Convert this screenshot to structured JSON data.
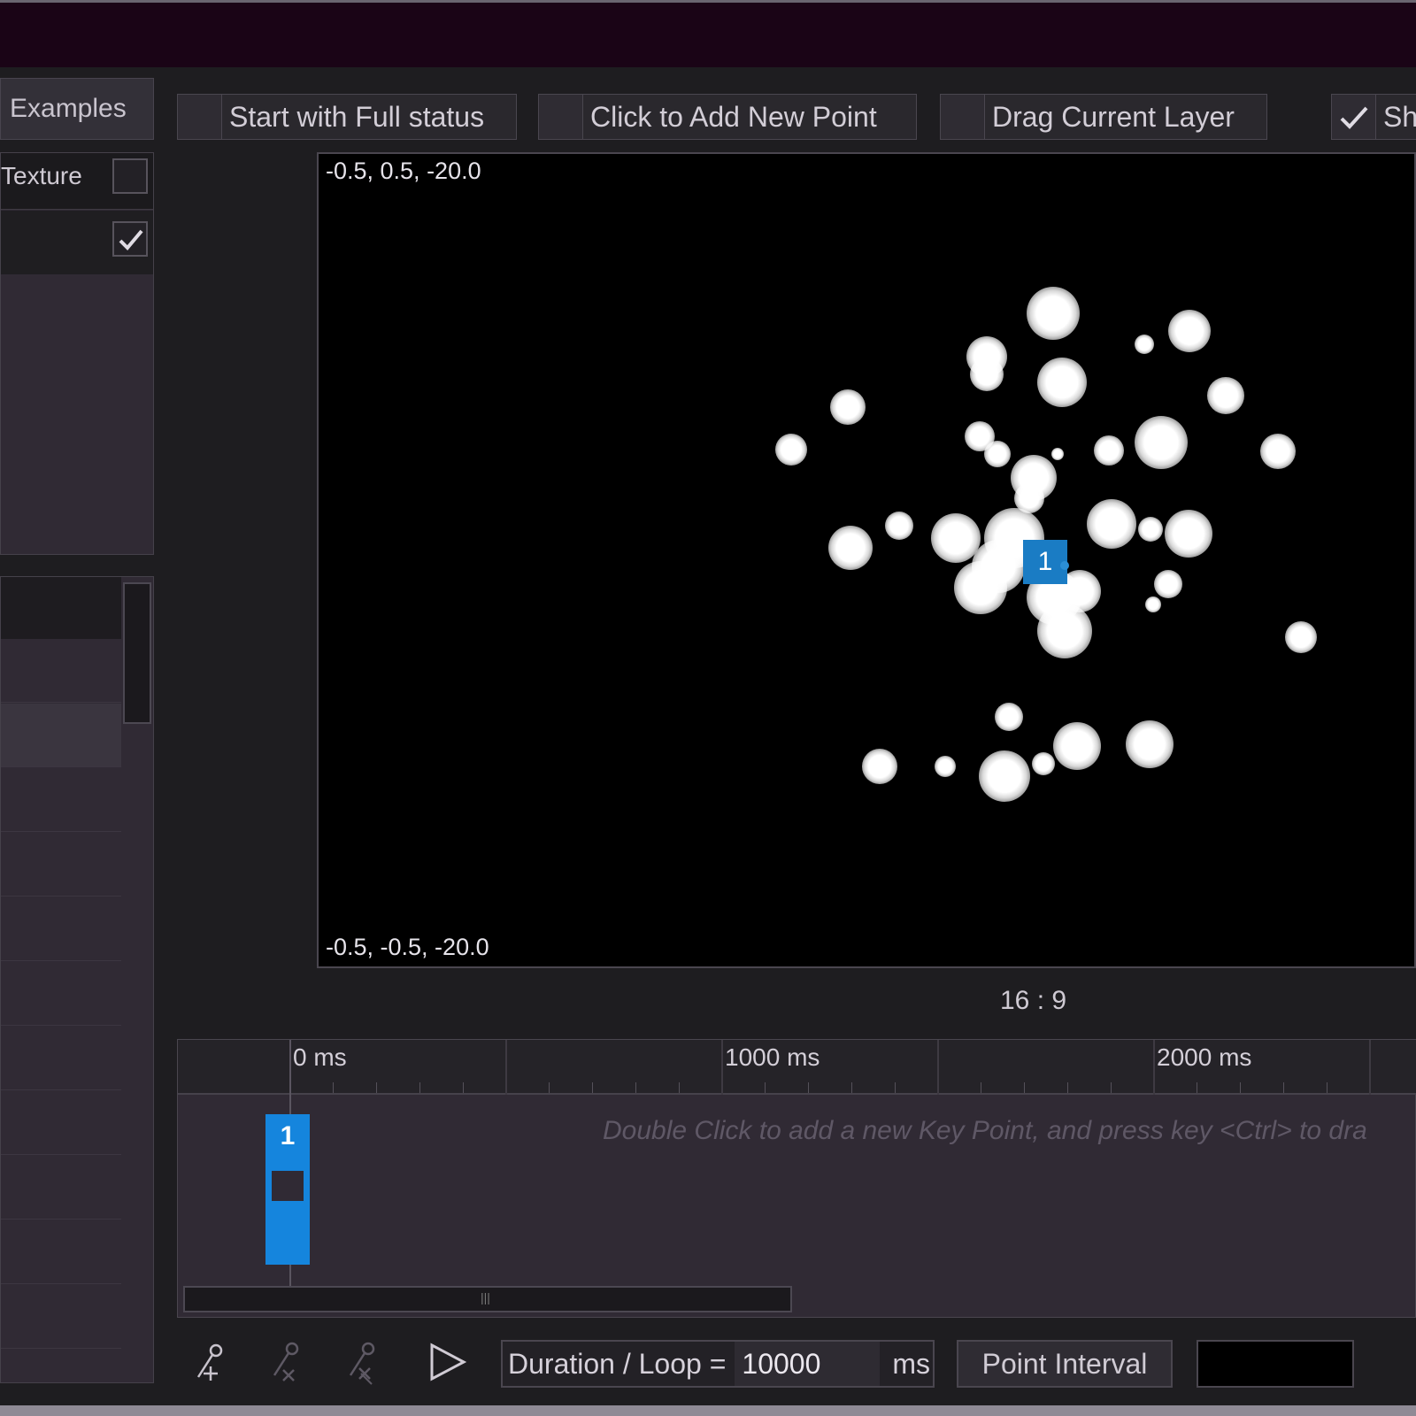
{
  "left_panel": {
    "examples_label": "Examples",
    "texture_label": "Texture",
    "texture_checked": false,
    "row2_checked": true
  },
  "toolbar": {
    "start_full_status": {
      "label": "Start with Full status",
      "checked": false
    },
    "click_add_point": {
      "label": "Click to Add New Point",
      "checked": false
    },
    "drag_layer": {
      "label": "Drag Current Layer",
      "checked": false
    },
    "show": {
      "label": "Sh",
      "checked": true
    }
  },
  "canvas": {
    "top_coord": "-0.5, 0.5, -20.0",
    "bottom_coord": "-0.5, -0.5, -20.0",
    "marker_label": "1"
  },
  "aspect_ratio": "16 : 9",
  "timeline": {
    "ruler_labels": [
      "0 ms",
      "1000 ms",
      "2000 ms"
    ],
    "hint": "Double Click to add a new Key Point, and press key <Ctrl> to dra",
    "key_label": "1"
  },
  "bottom_bar": {
    "duration_label": "Duration / Loop =",
    "duration_value": "10000",
    "duration_unit": "ms",
    "point_interval_label": "Point Interval"
  },
  "icons": [
    "add-keypoint-icon",
    "remove-keypoint-icon",
    "clear-keypoints-icon",
    "play-icon"
  ],
  "colors": {
    "accent_blue": "#1585dd",
    "title_bar": "#1a0416"
  }
}
